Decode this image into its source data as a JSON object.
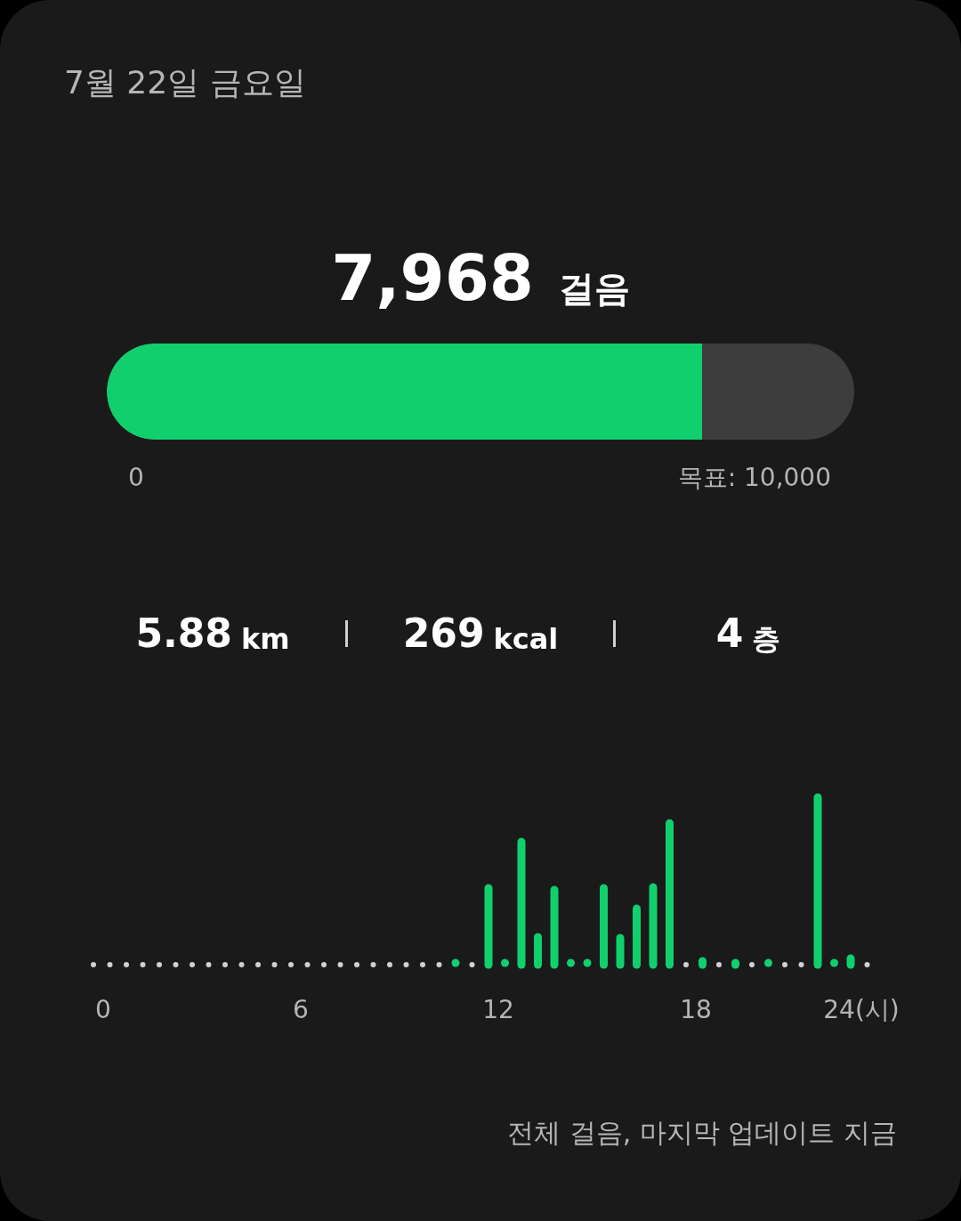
{
  "date": "7월 22일 금요일",
  "steps": {
    "value": "7,968",
    "unit": "걸음",
    "level": 0.7968,
    "min_label": "0",
    "goal_label": "목표: 10,000"
  },
  "stats": [
    {
      "value": "5.88",
      "unit": "km"
    },
    {
      "value": "269",
      "unit": "kcal"
    },
    {
      "value": "4",
      "unit": "층"
    }
  ],
  "chart": {
    "kind": "picture",
    "x_labels": [
      "0",
      "6",
      "12",
      "18",
      "24(시)"
    ]
  },
  "footer": "전체 걸음, 마지막 업데이트 지금"
}
